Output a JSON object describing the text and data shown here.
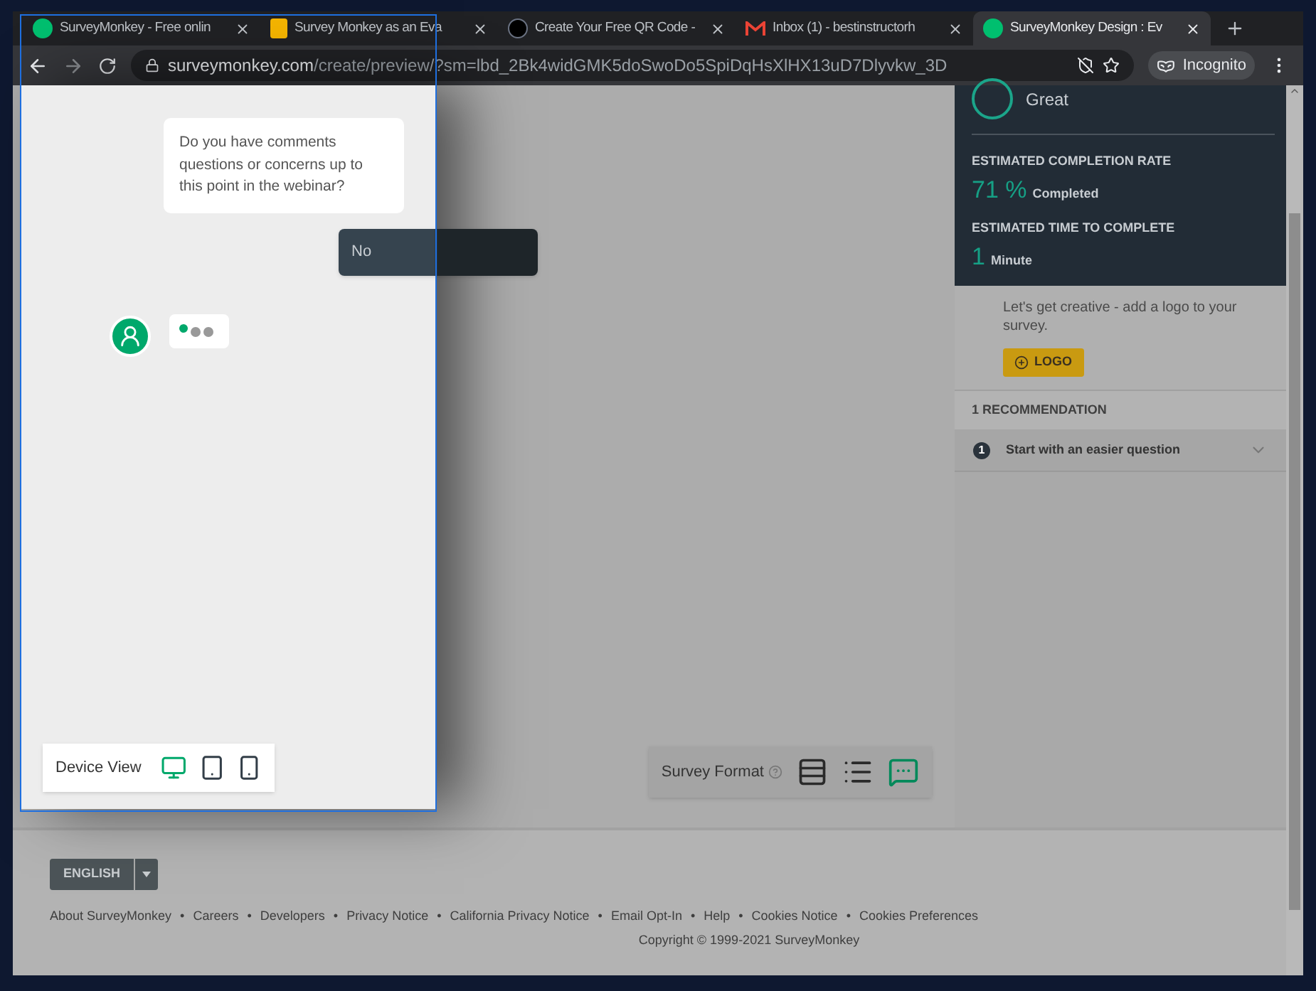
{
  "browser": {
    "tabs": [
      {
        "title": "SurveyMonkey - Free onlin",
        "kind": "monkey",
        "selected": false
      },
      {
        "title": "Survey Monkey as an Eva",
        "kind": "slides",
        "selected": false
      },
      {
        "title": "Create Your Free QR Code -",
        "kind": "qr",
        "selected": false
      },
      {
        "title": "Inbox (1) - bestinstructorh",
        "kind": "mail",
        "selected": false
      },
      {
        "title": "SurveyMonkey Design : Ev",
        "kind": "monkey",
        "selected": true
      }
    ],
    "url": {
      "host": "surveymonkey.com",
      "path": "/create/preview/?sm=lbd_2Bk4widGMK5doSwoDo5SpiDqHsXlHX13uD7Dlyvkw_3D"
    },
    "profile": "Incognito"
  },
  "preview": {
    "question": "Do you have comments questions or concerns up to this point in the webinar?",
    "answer": "No",
    "device_view": {
      "label": "Device View",
      "devices": [
        {
          "kind": "desktop",
          "selected": true
        },
        {
          "kind": "tablet",
          "selected": false
        },
        {
          "kind": "phone",
          "selected": false
        }
      ]
    }
  },
  "survey_format": {
    "label": "Survey Format",
    "formats": [
      {
        "kind": "classic",
        "selected": false
      },
      {
        "kind": "one",
        "selected": false
      },
      {
        "kind": "chat",
        "selected": true
      }
    ]
  },
  "panel": {
    "rating": "Great",
    "completion_label": "ESTIMATED COMPLETION RATE",
    "completion_value": "71 %",
    "completion_unit": "Completed",
    "time_label": "ESTIMATED TIME TO COMPLETE",
    "time_value": "1",
    "time_unit": "Minute",
    "logo_text": "Let's get creative - add a logo to your survey.",
    "logo_button": "LOGO",
    "recommendations_title": "1 RECOMMENDATION",
    "recommendations": [
      {
        "number": "1",
        "text": "Start with an easier question",
        "expanded": false
      }
    ]
  },
  "footer": {
    "language": "ENGLISH",
    "separator": "•",
    "links": [
      "About SurveyMonkey",
      "Careers",
      "Developers",
      "Privacy Notice",
      "California Privacy Notice",
      "Email Opt-In",
      "Help",
      "Cookies Notice",
      "Cookies Preferences"
    ],
    "copyright": "Copyright © 1999-2021 SurveyMonkey"
  }
}
